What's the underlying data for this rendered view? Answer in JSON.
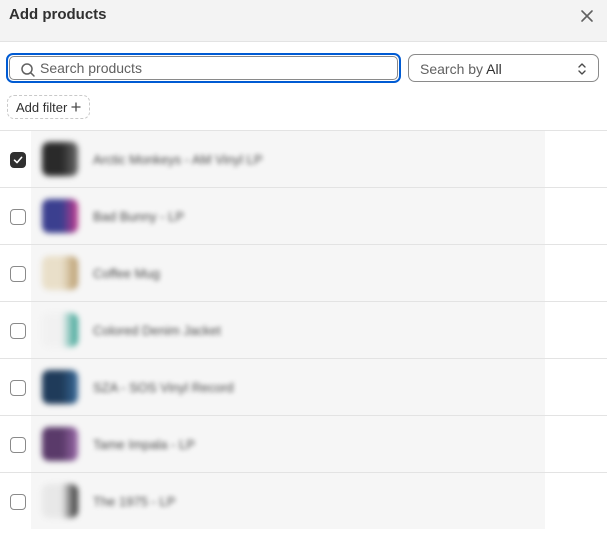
{
  "modal": {
    "title": "Add products"
  },
  "search": {
    "placeholder": "Search products",
    "value": ""
  },
  "search_by": {
    "label": "Search by",
    "value": "All"
  },
  "filter": {
    "label": "Add filter",
    "icon": "plus-icon"
  },
  "products": [
    {
      "name": "Arctic Monkeys - AM Vinyl LP",
      "checked": true,
      "thumb_colors": [
        "#2a2a2a",
        "#6b6b6b"
      ]
    },
    {
      "name": "Bad Bunny - LP",
      "checked": false,
      "thumb_colors": [
        "#3b3f8f",
        "#c23a8e"
      ]
    },
    {
      "name": "Coffee Mug",
      "checked": false,
      "thumb_colors": [
        "#e9dfc9",
        "#b89a6a"
      ]
    },
    {
      "name": "Colored Denim Jacket",
      "checked": false,
      "thumb_colors": [
        "#f1f1f1",
        "#2f9e8e"
      ]
    },
    {
      "name": "SZA - SOS Vinyl Record",
      "checked": false,
      "thumb_colors": [
        "#1f3b5a",
        "#3a6b9a"
      ]
    },
    {
      "name": "Tame Impala - LP",
      "checked": false,
      "thumb_colors": [
        "#5a3a6a",
        "#9a6aa8"
      ]
    },
    {
      "name": "The 1975 - LP",
      "checked": false,
      "thumb_colors": [
        "#e8e8e8",
        "#2a2a2a"
      ]
    }
  ]
}
